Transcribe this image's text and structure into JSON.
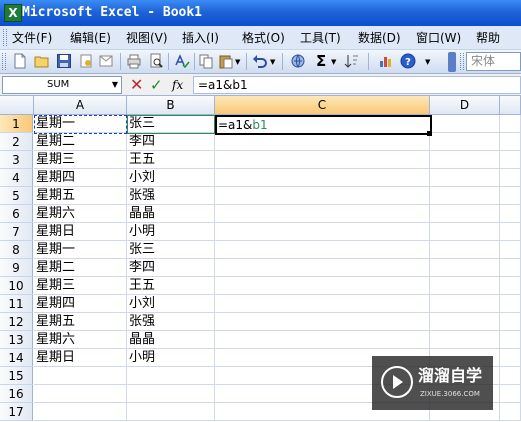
{
  "window": {
    "app_icon_letter": "X",
    "title": "Microsoft Excel - Book1"
  },
  "menu": [
    {
      "label": "文件(F)"
    },
    {
      "label": "编辑(E)"
    },
    {
      "label": "视图(V)"
    },
    {
      "label": "插入(I)"
    },
    {
      "label": "格式(O)"
    },
    {
      "label": "工具(T)"
    },
    {
      "label": "数据(D)"
    },
    {
      "label": "窗口(W)"
    },
    {
      "label": "帮助"
    }
  ],
  "toolbar": {
    "icons": [
      "new-icon",
      "open-icon",
      "save-icon",
      "permission-icon",
      "email-icon",
      "print-icon",
      "print-preview-icon",
      "spelling-icon",
      "copy-icon",
      "paste-icon",
      "undo-icon",
      "hyperlink-icon",
      "autosum-icon",
      "sort-icon",
      "chart-icon",
      "help-icon"
    ],
    "autosum_symbol": "Σ",
    "font_name": "宋体"
  },
  "formula_bar": {
    "name_box": "SUM",
    "cancel_symbol": "✕",
    "enter_symbol": "✓",
    "fx_label": "fx",
    "formula": "=a1&b1"
  },
  "sheet": {
    "columns": [
      "A",
      "B",
      "C",
      "D"
    ],
    "active_column": "C",
    "active_row": "1",
    "rows": [
      {
        "num": "1",
        "a": "星期一",
        "b": "张三"
      },
      {
        "num": "2",
        "a": "星期二",
        "b": "李四"
      },
      {
        "num": "3",
        "a": "星期三",
        "b": "王五"
      },
      {
        "num": "4",
        "a": "星期四",
        "b": "小刘"
      },
      {
        "num": "5",
        "a": "星期五",
        "b": "张强"
      },
      {
        "num": "6",
        "a": "星期六",
        "b": "晶晶"
      },
      {
        "num": "7",
        "a": "星期日",
        "b": "小明"
      },
      {
        "num": "8",
        "a": "星期一",
        "b": "张三"
      },
      {
        "num": "9",
        "a": "星期二",
        "b": "李四"
      },
      {
        "num": "10",
        "a": "星期三",
        "b": "王五"
      },
      {
        "num": "11",
        "a": "星期四",
        "b": "小刘"
      },
      {
        "num": "12",
        "a": "星期五",
        "b": "张强"
      },
      {
        "num": "13",
        "a": "星期六",
        "b": "晶晶"
      },
      {
        "num": "14",
        "a": "星期日",
        "b": "小明"
      },
      {
        "num": "15",
        "a": "",
        "b": ""
      },
      {
        "num": "16",
        "a": "",
        "b": ""
      },
      {
        "num": "17",
        "a": "",
        "b": ""
      }
    ],
    "editing_cell": {
      "prefix": "=a1&",
      "ref": "b1"
    }
  },
  "watermark": {
    "title": "溜溜自学",
    "subtitle": "ZIXUE.3066.COM"
  },
  "colors": {
    "ref_a1_border": "#1c3fb0",
    "ref_b1": "#2e8b57",
    "active_header": "#f8c878"
  }
}
